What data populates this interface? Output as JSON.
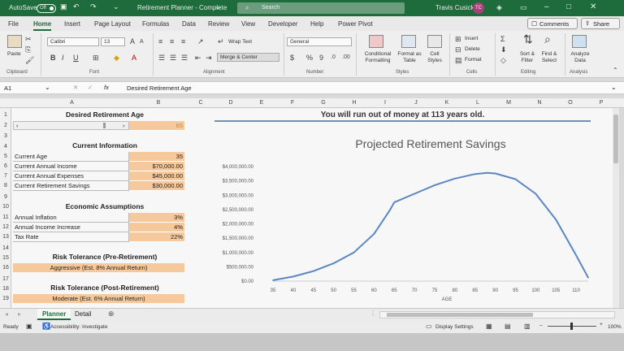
{
  "title_bar": {
    "autosave_label": "AutoSave",
    "autosave_state": "Off",
    "document_title": "Retirement Planner - Complete",
    "search_placeholder": "Search",
    "user_name": "Travis Cusick",
    "user_initials": "TC"
  },
  "tabs": [
    "File",
    "Home",
    "Insert",
    "Page Layout",
    "Formulas",
    "Data",
    "Review",
    "View",
    "Developer",
    "Help",
    "Power Pivot"
  ],
  "selected_tab": "Home",
  "comments_label": "Comments",
  "share_label": "Share",
  "ribbon": {
    "paste_label": "Paste",
    "font_name": "Calibri",
    "font_size": "13",
    "wrap_text": "Wrap Text",
    "merge_center": "Merge & Center",
    "number_format": "General",
    "conditional_formatting": "Conditional Formatting",
    "format_as_table": "Format as Table",
    "cell_styles": "Cell Styles",
    "insert": "Insert",
    "delete": "Delete",
    "format": "Format",
    "sort_filter": "Sort & Filter",
    "find_select": "Find & Select",
    "analyze_data": "Analyze Data",
    "groups": [
      "Clipboard",
      "Font",
      "Alignment",
      "Number",
      "Styles",
      "Cells",
      "Editing",
      "Analysis"
    ]
  },
  "formula_bar": {
    "name_box": "A1",
    "fx": "fx",
    "content": "Desired Retirement Age"
  },
  "columns": [
    "A",
    "B",
    "C",
    "D",
    "E",
    "F",
    "G",
    "H",
    "I",
    "J",
    "K",
    "L",
    "M",
    "N",
    "O",
    "P"
  ],
  "rows": [
    "1",
    "2",
    "3",
    "4",
    "5",
    "6",
    "7",
    "8",
    "9",
    "10",
    "11",
    "12",
    "13",
    "14",
    "15",
    "16",
    "17",
    "18",
    "19"
  ],
  "sheet": {
    "desired_age_title": "Desired Retirement Age",
    "desired_age_value": "65",
    "current_info_title": "Current Information",
    "current_info": [
      {
        "label": "Current Age",
        "value": "35"
      },
      {
        "label": "Current Annual Income",
        "value": "$70,000.00"
      },
      {
        "label": "Current Annual Expenses",
        "value": "$45,000.00"
      },
      {
        "label": "Current Retirement Savings",
        "value": "$30,000.00"
      }
    ],
    "econ_title": "Economic Assumptions",
    "econ": [
      {
        "label": "Annual Inflation",
        "value": "3%"
      },
      {
        "label": "Annual Income Increase",
        "value": "4%"
      },
      {
        "label": "Tax Rate",
        "value": "22%"
      }
    ],
    "risk_pre_title": "Risk Tolerance (Pre-Retirement)",
    "risk_pre_value": "Aggressive  (Est. 8% Annual Return)",
    "risk_post_title": "Risk Tolerance (Post-Retirement)",
    "risk_post_value": "Moderate  (Est. 6% Annual Return)",
    "banner": "You will run out of money at 113 years old."
  },
  "chart_data": {
    "type": "line",
    "title": "Projected Retirement Savings",
    "xlabel": "AGE",
    "ylabel": "",
    "x": [
      35,
      40,
      45,
      50,
      55,
      60,
      64,
      65,
      70,
      75,
      80,
      85,
      88,
      90,
      95,
      100,
      105,
      110,
      113
    ],
    "series": [
      {
        "values": [
          30000,
          160000,
          350000,
          620000,
          1000000,
          1650000,
          2500000,
          2750000,
          3050000,
          3350000,
          3580000,
          3740000,
          3780000,
          3760000,
          3560000,
          3050000,
          2150000,
          900000,
          120000
        ]
      }
    ],
    "x_ticks": [
      35,
      40,
      45,
      50,
      55,
      60,
      65,
      70,
      75,
      80,
      85,
      90,
      95,
      100,
      105,
      110
    ],
    "y_ticks": [
      "$0.00",
      "$500,000.00",
      "$1,000,000.00",
      "$1,500,000.00",
      "$2,000,000.00",
      "$2,500,000.00",
      "$3,000,000.00",
      "$3,500,000.00",
      "$4,000,000.00"
    ],
    "ylim": [
      0,
      4000000
    ],
    "xlim": [
      35,
      113
    ],
    "grid": false,
    "line_color": "#5b86c0"
  },
  "sheet_tabs": [
    "Planner",
    "Detail"
  ],
  "active_sheet": "Planner",
  "status_bar": {
    "ready": "Ready",
    "accessibility": "Accessibility: Investigate",
    "display_settings": "Display Settings",
    "zoom": "100%"
  }
}
